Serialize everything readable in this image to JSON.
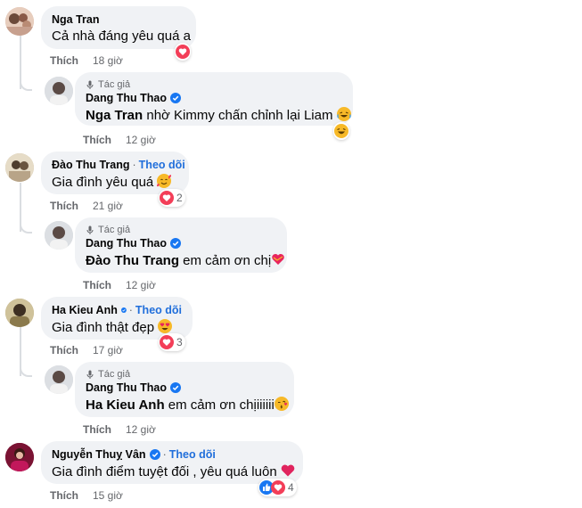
{
  "comments": [
    {
      "id": "c1",
      "name": "Nga Tran",
      "verified": false,
      "follow": "",
      "text": "Cả nhà đáng yêu quá a",
      "like": "Thích",
      "time": "18 giờ",
      "reactions": {
        "icons": [
          "heart-icon"
        ],
        "count": ""
      },
      "avatar_color": "#c9a48a",
      "reply": {
        "author_badge": "Tác giả",
        "name": "Dang Thu Thao",
        "verified": true,
        "mention": "Nga Tran",
        "text": "nhờ Kimmy chấn chỉnh lại Liam",
        "emoji": "laughing-emoji-icon",
        "like": "Thích",
        "time": "12 giờ",
        "reactions": {
          "icons": [
            "laughing-icon"
          ],
          "count": ""
        }
      }
    },
    {
      "id": "c2",
      "name": "Đào Thu Trang",
      "verified": false,
      "follow": "Theo dõi",
      "text": "Gia đình yêu quá",
      "emoji": "smiling-hearts-emoji-icon",
      "like": "Thích",
      "time": "21 giờ",
      "reactions": {
        "icons": [
          "heart-icon"
        ],
        "count": "2"
      },
      "avatar_color": "#b9a88e",
      "reply": {
        "author_badge": "Tác giả",
        "name": "Dang Thu Thao",
        "verified": true,
        "mention": "Đào Thu Trang",
        "text": "em cảm ơn chị",
        "emoji": "heart-ribbon-emoji-icon",
        "like": "Thích",
        "time": "12 giờ"
      }
    },
    {
      "id": "c3",
      "name": "Ha Kieu Anh",
      "verified": true,
      "follow": "Theo dõi",
      "text": "Gia đình thật đẹp",
      "emoji": "heart-eyes-emoji-icon",
      "like": "Thích",
      "time": "17 giờ",
      "reactions": {
        "icons": [
          "heart-icon"
        ],
        "count": "3"
      },
      "avatar_color": "#a7956b",
      "reply": {
        "author_badge": "Tác giả",
        "name": "Dang Thu Thao",
        "verified": true,
        "mention": "Ha Kieu Anh",
        "text": "em cảm ơn chịiiiiii",
        "emoji": "kiss-emoji-icon",
        "like": "Thích",
        "time": "12 giờ"
      }
    },
    {
      "id": "c4",
      "name": "Nguyễn Thuỵ Vân",
      "verified": true,
      "follow": "Theo dõi",
      "text": "Gia đình điểm tuyệt đối , yêu quá luôn",
      "emoji": "red-heart-emoji-icon",
      "like": "Thích",
      "time": "15 giờ",
      "reactions": {
        "icons": [
          "like-icon",
          "heart-icon"
        ],
        "count": "4"
      },
      "avatar_color": "#8b1e3f"
    }
  ],
  "colors": {
    "bubble": "#f0f2f5",
    "link": "#216fdb",
    "verified": "#1877f2",
    "heart": "#f33e58",
    "secondary_text": "#65676b"
  }
}
